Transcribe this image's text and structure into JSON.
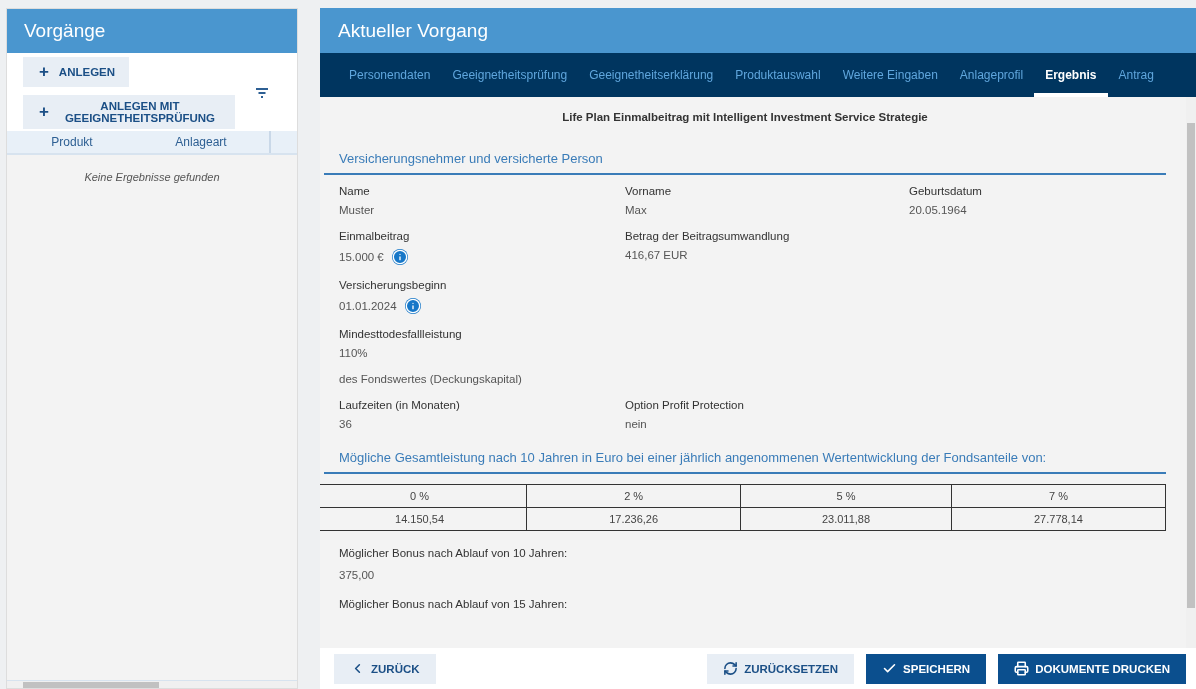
{
  "sidebar": {
    "title": "Vorgänge",
    "buttons": [
      {
        "icon": "+",
        "label": "ANLEGEN"
      },
      {
        "icon": "+",
        "label": "ANLEGEN MIT GEEIGNETHEITSPRÜFUNG"
      }
    ],
    "columns": [
      "Produkt",
      "Anlageart"
    ],
    "empty_text": "Keine Ergebnisse gefunden"
  },
  "main": {
    "title": "Aktueller Vorgang",
    "tabs": [
      {
        "label": "Personendaten",
        "selected": false
      },
      {
        "label": "Geeignetheitsprüfung",
        "selected": false
      },
      {
        "label": "Geeignetheitserklärung",
        "selected": false
      },
      {
        "label": "Produktauswahl",
        "selected": false
      },
      {
        "label": "Weitere Eingaben",
        "selected": false
      },
      {
        "label": "Anlageprofil",
        "selected": false
      },
      {
        "label": "Ergebnis",
        "selected": true
      },
      {
        "label": "Antrag",
        "selected": false
      }
    ],
    "product_title": "Life Plan Einmalbeitrag mit Intelligent Investment Service Strategie",
    "section_title": "Versicherungsnehmer und versicherte Person",
    "rows": [
      {
        "kind": "fields",
        "fields": [
          {
            "label": "Name",
            "value": "Muster",
            "info": false
          },
          {
            "label": "Vorname",
            "value": "Max",
            "info": false
          },
          {
            "label": "Geburtsdatum",
            "value": "20.05.1964",
            "info": false
          }
        ]
      },
      {
        "kind": "fields",
        "fields": [
          {
            "label": "Einmalbeitrag",
            "value": "15.000 €",
            "info": true
          },
          {
            "label": "Betrag der Beitragsumwandlung",
            "value": "416,67 EUR",
            "info": false
          }
        ]
      },
      {
        "kind": "fields",
        "fields": [
          {
            "label": "Versicherungsbeginn",
            "value": "01.01.2024",
            "info": true
          }
        ]
      },
      {
        "kind": "fields",
        "fields": [
          {
            "label": "Mindesttodesfallleistung",
            "value": "110%",
            "info": false
          }
        ]
      },
      {
        "kind": "note",
        "text": "des Fondswertes (Deckungskapital)"
      },
      {
        "kind": "fields",
        "fields": [
          {
            "label": "Laufzeiten (in Monaten)",
            "value": "36",
            "info": false
          },
          {
            "label": "Option Profit Protection",
            "value": "nein",
            "info": false
          }
        ]
      }
    ],
    "table_title": "Mögliche Gesamtleistung nach 10 Jahren in Euro bei einer jährlich angenommenen Wertentwicklung der Fondsanteile von:",
    "table": {
      "columns": [
        "0 %",
        "2 %",
        "5 %",
        "7 %"
      ],
      "values": [
        "14.150,54",
        "17.236,26",
        "23.011,88",
        "27.778,14"
      ]
    },
    "bonus": [
      {
        "label": "Möglicher Bonus nach Ablauf von 10 Jahren:",
        "value": "375,00"
      },
      {
        "label": "Möglicher Bonus nach Ablauf von 15 Jahren:"
      }
    ],
    "footer": [
      {
        "kind": "back",
        "label": "ZURÜCK"
      },
      {
        "kind": "reset",
        "label": "ZURÜCKSETZEN"
      },
      {
        "kind": "save",
        "label": "SPEICHERN"
      },
      {
        "kind": "print",
        "label": "DOKUMENTE DRUCKEN"
      }
    ]
  }
}
